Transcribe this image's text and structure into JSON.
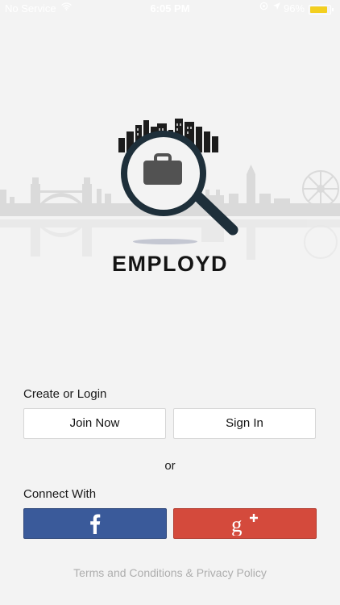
{
  "status_bar": {
    "carrier": "No Service",
    "time": "6:05 PM",
    "battery_percent": "96%",
    "battery_level": 0.96,
    "icons": [
      "wifi-icon",
      "location-icon",
      "navigation-arrow-icon",
      "battery-icon"
    ]
  },
  "brand": {
    "name": "EMPLOYD",
    "logo": "magnifying-glass-briefcase-cityscape-logo",
    "background": "city-skyline-illustration"
  },
  "auth": {
    "section_label": "Create or Login",
    "join_label": "Join Now",
    "signin_label": "Sign In"
  },
  "divider_text": "or",
  "social": {
    "section_label": "Connect With",
    "facebook_icon": "facebook-icon",
    "google_icon": "google-plus-icon",
    "facebook_color": "#3a5a9a",
    "google_color": "#d44a3c"
  },
  "footer": {
    "terms_text": "Terms and Conditions & Privacy Policy"
  },
  "colors": {
    "background": "#f3f3f3",
    "skyline": "#dadada",
    "logo_ring": "#1e2f3a",
    "terms_text": "#aeaeae"
  }
}
